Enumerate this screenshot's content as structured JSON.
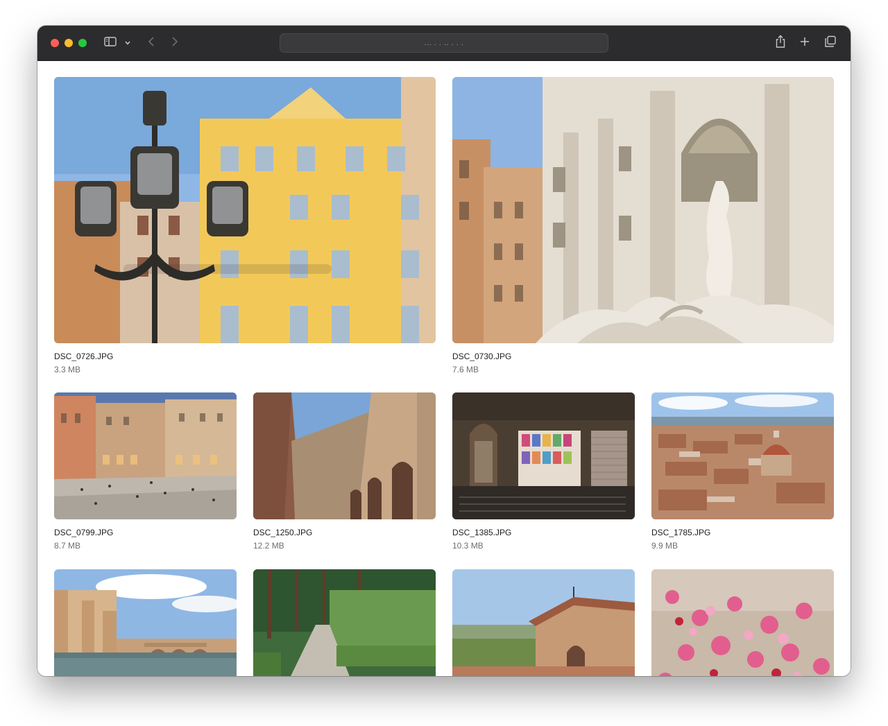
{
  "toolbar": {
    "address": "...   .   .   ..   .   .  ."
  },
  "files": [
    {
      "name": "DSC_0726.JPG",
      "size": "3.3 MB"
    },
    {
      "name": "DSC_0730.JPG",
      "size": "7.6 MB"
    },
    {
      "name": "DSC_0799.JPG",
      "size": "8.7 MB"
    },
    {
      "name": "DSC_1250.JPG",
      "size": "12.2 MB"
    },
    {
      "name": "DSC_1385.JPG",
      "size": "10.3 MB"
    },
    {
      "name": "DSC_1785.JPG",
      "size": "9.9 MB"
    },
    {
      "name": "",
      "size": ""
    },
    {
      "name": "",
      "size": ""
    },
    {
      "name": "",
      "size": ""
    },
    {
      "name": "",
      "size": ""
    }
  ],
  "icons": {
    "sidebar": "sidebar-icon",
    "chevron": "chevron-down-icon",
    "back": "back-icon",
    "forward": "forward-icon",
    "share": "share-icon",
    "new_tab": "plus-icon",
    "tabs": "tab-overview-icon"
  },
  "colors": {
    "toolbar": "#2c2c2e",
    "close": "#ff5f57",
    "minimize": "#febc2e",
    "zoom": "#28c840"
  }
}
